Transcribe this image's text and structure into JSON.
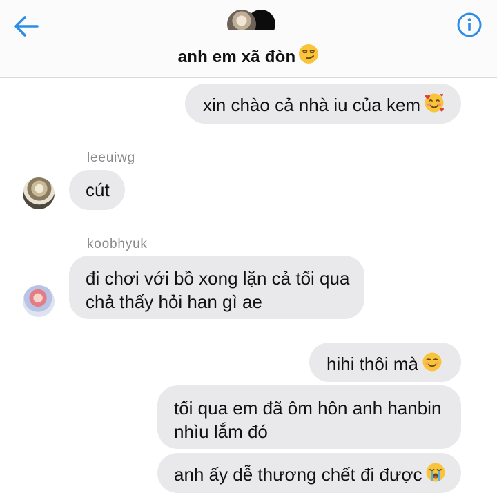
{
  "header": {
    "title": "anh em xã đòn",
    "title_emoji": "smirking-face-emoji",
    "back_icon": "back-arrow-icon",
    "info_icon": "info-icon"
  },
  "messages": [
    {
      "direction": "outgoing",
      "lines": [
        "xin chào cả nhà iu của kem"
      ],
      "emoji": "smiling-face-with-hearts-emoji"
    },
    {
      "direction": "incoming",
      "sender": "leeuiwg",
      "lines": [
        "cút"
      ]
    },
    {
      "direction": "incoming",
      "sender": "koobhyuk",
      "lines": [
        "đi chơi với bồ xong lặn cả tối qua",
        "chả thấy hỏi han gì ae"
      ]
    },
    {
      "direction": "outgoing",
      "lines": [
        "hihi thôi mà"
      ],
      "emoji": "smiling-face-emoji"
    },
    {
      "direction": "outgoing",
      "lines": [
        "tối qua em đã ôm hôn anh hanbin",
        "nhìu lắm đó"
      ]
    },
    {
      "direction": "outgoing",
      "lines": [
        "anh ấy dễ thương chết đi được"
      ],
      "emoji": "loudly-crying-face-emoji"
    }
  ],
  "colors": {
    "accent": "#2d8ce6",
    "bubble": "#e9e9eb",
    "sender_text": "#8a8a8e"
  }
}
